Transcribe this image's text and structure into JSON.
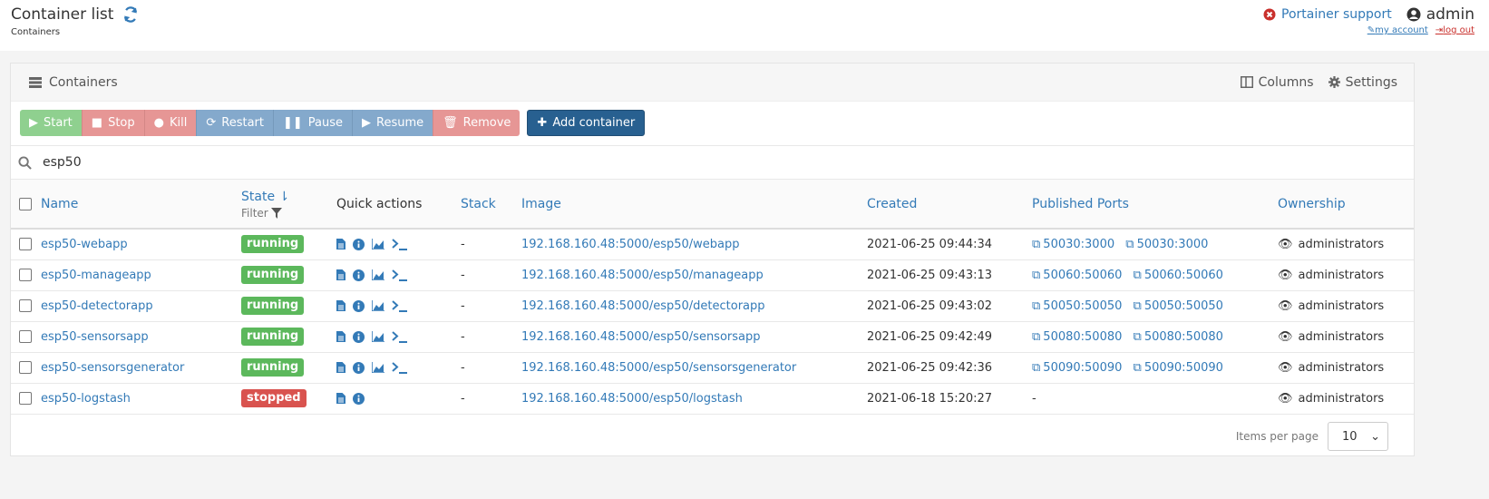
{
  "header": {
    "title": "Container list",
    "breadcrumb": "Containers",
    "support_label": "Portainer support",
    "user_name": "admin",
    "my_account": "my account",
    "log_out": "log out"
  },
  "panel": {
    "title": "Containers",
    "columns_label": "Columns",
    "settings_label": "Settings"
  },
  "actions": {
    "start": "Start",
    "stop": "Stop",
    "kill": "Kill",
    "restart": "Restart",
    "pause": "Pause",
    "resume": "Resume",
    "remove": "Remove",
    "add": "Add container"
  },
  "search": {
    "value": "esp50"
  },
  "table": {
    "headers": {
      "name": "Name",
      "state": "State",
      "filter": "Filter",
      "quick_actions": "Quick actions",
      "stack": "Stack",
      "image": "Image",
      "created": "Created",
      "ports": "Published Ports",
      "ownership": "Ownership"
    },
    "rows": [
      {
        "name": "esp50-webapp",
        "state": "running",
        "stack": "-",
        "image": "192.168.160.48:5000/esp50/webapp",
        "created": "2021-06-25 09:44:34",
        "port1": "50030:3000",
        "port2": "50030:3000",
        "ownership": "administrators"
      },
      {
        "name": "esp50-manageapp",
        "state": "running",
        "stack": "-",
        "image": "192.168.160.48:5000/esp50/manageapp",
        "created": "2021-06-25 09:43:13",
        "port1": "50060:50060",
        "port2": "50060:50060",
        "ownership": "administrators"
      },
      {
        "name": "esp50-detectorapp",
        "state": "running",
        "stack": "-",
        "image": "192.168.160.48:5000/esp50/detectorapp",
        "created": "2021-06-25 09:43:02",
        "port1": "50050:50050",
        "port2": "50050:50050",
        "ownership": "administrators"
      },
      {
        "name": "esp50-sensorsapp",
        "state": "running",
        "stack": "-",
        "image": "192.168.160.48:5000/esp50/sensorsapp",
        "created": "2021-06-25 09:42:49",
        "port1": "50080:50080",
        "port2": "50080:50080",
        "ownership": "administrators"
      },
      {
        "name": "esp50-sensorsgenerator",
        "state": "running",
        "stack": "-",
        "image": "192.168.160.48:5000/esp50/sensorsgenerator",
        "created": "2021-06-25 09:42:36",
        "port1": "50090:50090",
        "port2": "50090:50090",
        "ownership": "administrators"
      },
      {
        "name": "esp50-logstash",
        "state": "stopped",
        "stack": "-",
        "image": "192.168.160.48:5000/esp50/logstash",
        "created": "2021-06-18 15:20:27",
        "ports_empty": "-",
        "ownership": "administrators"
      }
    ]
  },
  "footer": {
    "items_per_page_label": "Items per page",
    "items_per_page_value": "10"
  },
  "colors": {
    "running": "#5cb85c",
    "stopped": "#d9534f",
    "link": "#337ab7",
    "primary": "#286090"
  }
}
